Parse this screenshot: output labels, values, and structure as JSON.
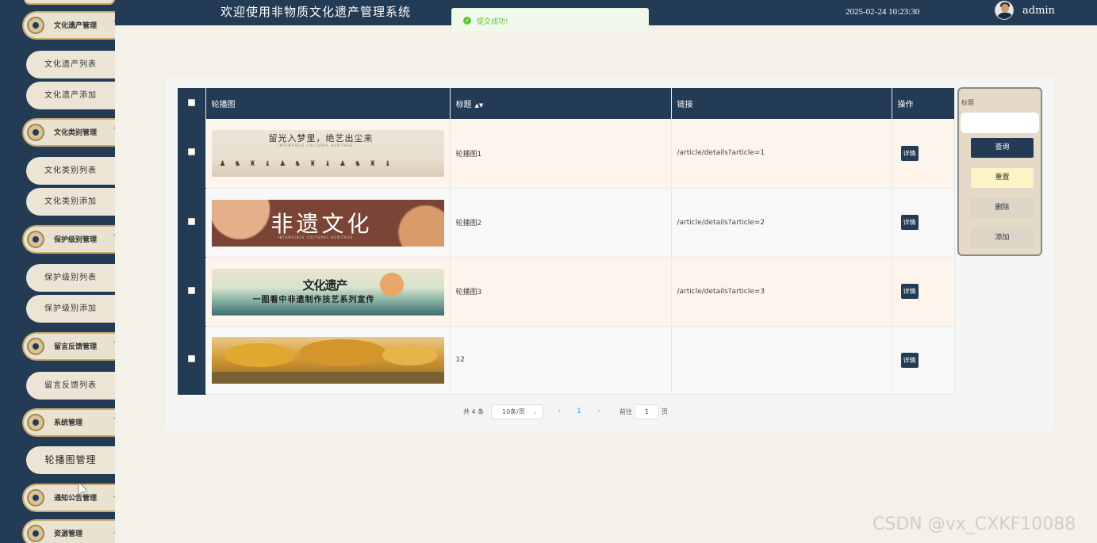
{
  "header": {
    "title": "欢迎使用非物质文化遗产管理系统",
    "datetime": "2025-02-24 10:23:30",
    "username": "admin"
  },
  "toast": {
    "message": "提交成功!"
  },
  "sidebar": {
    "groups": [
      {
        "label": "文化遗产管理",
        "items": [
          "文化遗产列表",
          "文化遗产添加"
        ]
      },
      {
        "label": "文化类别管理",
        "items": [
          "文化类别列表",
          "文化类别添加"
        ]
      },
      {
        "label": "保护级别管理",
        "items": [
          "保护级别列表",
          "保护级别添加"
        ]
      },
      {
        "label": "留言反馈管理",
        "items": [
          "留言反馈列表"
        ]
      },
      {
        "label": "系统管理",
        "items": [
          "轮播图管理"
        ]
      },
      {
        "label": "通知公告管理",
        "items": []
      },
      {
        "label": "资源管理",
        "items": []
      }
    ],
    "active_item": "轮播图管理"
  },
  "table": {
    "columns": [
      "轮播图",
      "标题",
      "链接",
      "操作"
    ],
    "rows": [
      {
        "title": "轮播图1",
        "link": "/article/details?article=1",
        "action": "详情",
        "banner": {
          "line1": "留光入梦里，绝艺出尘来",
          "line2": "INTANGIBLE CULTURAL HERITAGE"
        }
      },
      {
        "title": "轮播图2",
        "link": "/article/details?article=2",
        "action": "详情",
        "banner": {
          "line1": "非遗文化",
          "line2": "INTANGIBLE CULTURAL HERITAGE"
        }
      },
      {
        "title": "轮播图3",
        "link": "/article/details?article=3",
        "action": "详情",
        "banner": {
          "line1": "文化遗产",
          "line2": "一图看中非遗制作技艺系列宣传"
        }
      },
      {
        "title": "12",
        "link": "",
        "action": "详情",
        "banner": {}
      }
    ]
  },
  "search": {
    "label": "标题",
    "placeholder": "",
    "buttons": {
      "query": "查询",
      "reset": "重置",
      "delete": "删除",
      "add": "添加"
    }
  },
  "pagination": {
    "total": "共 4 条",
    "page_size": "10条/页",
    "current": "1",
    "goto_label": "前往",
    "goto_value": "1",
    "page_suffix": "页"
  },
  "watermark": "CSDN @vx_CXKF10088"
}
